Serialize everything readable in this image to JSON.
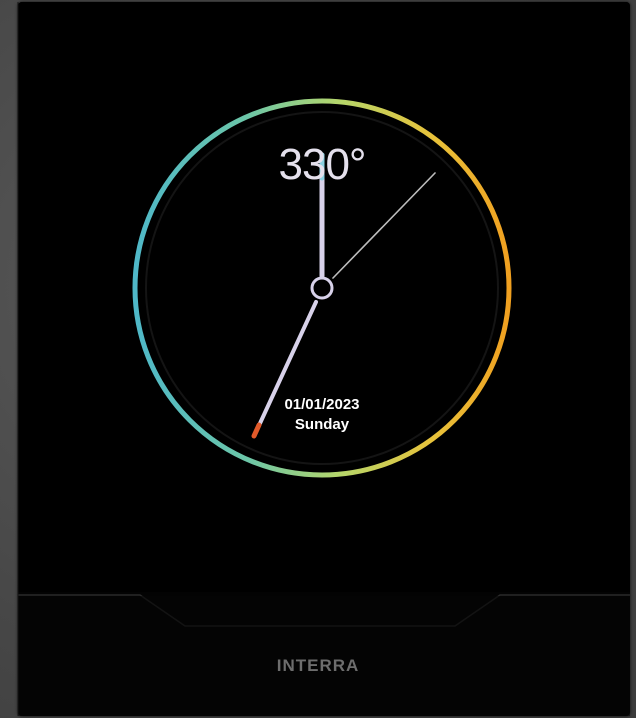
{
  "thermostat": {
    "temperature": "33",
    "temperature_tail": "0°",
    "date": "01/01/2023",
    "day": "Sunday"
  },
  "brand": {
    "name": "INTERRA"
  },
  "colors": {
    "ring_start": "#4fb8c8",
    "ring_mid": "#a6d36b",
    "ring_end": "#f0a020",
    "hand": "#d8d2ea",
    "accent_tip": "#e25a2a"
  }
}
